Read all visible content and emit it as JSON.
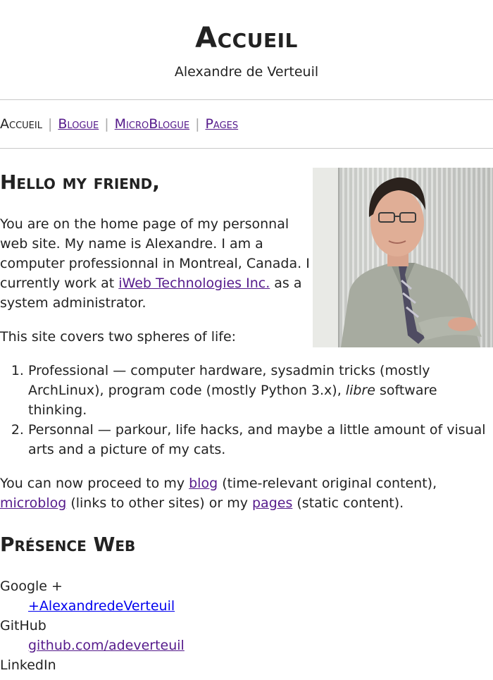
{
  "site": {
    "title": "Accueil",
    "subtitle": "Alexandre de Verteuil"
  },
  "nav": [
    {
      "label": "Accueil"
    },
    {
      "label": "Blogue"
    },
    {
      "label": "MicroBlogue"
    },
    {
      "label": "Pages"
    }
  ],
  "intro": {
    "heading": "Hello my friend,",
    "p1_before": "You are on the home page of my personnal web site. My name is Alexandre. I am a computer professionnal in Montreal, Canada. I currently work at ",
    "p1_link": "iWeb Technologies Inc.",
    "p1_after": " as a system administrator.",
    "p2": "This site covers two spheres of life:",
    "items": [
      {
        "before": "Professional — computer hardware, sysadmin tricks (mostly ArchLinux), program code (mostly Python 3.x), ",
        "em": "libre",
        "after": " software thinking."
      },
      {
        "text": "Personnal — parkour, life hacks, and maybe a little amount of visual arts and a picture of my cats."
      }
    ],
    "p3_a": "You can now proceed to my ",
    "p3_blog": "blog",
    "p3_b": " (time-relevant original content), ",
    "p3_microblog": "microblog",
    "p3_c": " (links to other sites) or my ",
    "p3_pages": "pages",
    "p3_d": " (static content)."
  },
  "presence": {
    "heading": "Présence Web",
    "items": [
      {
        "service": "Google +",
        "link": "+AlexandredeVerteuil"
      },
      {
        "service": "GitHub",
        "link": "github.com/adeverteuil"
      },
      {
        "service": "LinkedIn",
        "link": ""
      }
    ]
  },
  "colors": {
    "link_visited": "#551a8b",
    "link_unvisited": "#0000ee",
    "separator": "#c8c8c8",
    "text": "#222222"
  },
  "icons": {
    "portrait": "person-portrait-photo"
  }
}
